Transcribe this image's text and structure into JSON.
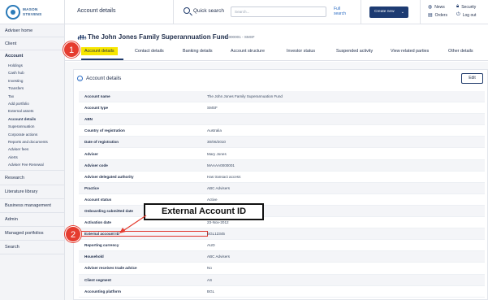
{
  "logo": {
    "line1": "MASON",
    "line2": "STEVENS"
  },
  "sidebar": {
    "items_top": [
      "Adviser home",
      "Client"
    ],
    "account_section": "Account",
    "account_sub": [
      "Holdings",
      "Cash hub",
      "Investing",
      "Transfers",
      "Tax",
      "Add portfolio",
      "External assets",
      "Account details",
      "Superannuation",
      "Corporate actions",
      "Reports and documents",
      "Adviser fees",
      "Alerts",
      "Adviser Fee Renewal"
    ],
    "active_sub": "Account details",
    "items_bottom": [
      "Research",
      "Literature library",
      "Business management",
      "Admin",
      "Managed portfolios",
      "Search"
    ]
  },
  "header": {
    "page_title": "Account details",
    "quick_search_label": "Quick search",
    "search_placeholder": "Search...",
    "full_search_line1": "Full",
    "full_search_line2": "search",
    "create_new_label": "Create new",
    "links": {
      "news": "News",
      "orders": "Orders",
      "security": "Security",
      "logout": "Log out"
    }
  },
  "fund": {
    "title": "The John Jones Family Superannuation Fund",
    "id": "MS1000001 - SMSF"
  },
  "tabs": [
    "Account details",
    "Contact details",
    "Banking details",
    "Account structure",
    "Investor status",
    "Suspended activity",
    "View related parties",
    "Other details"
  ],
  "panel": {
    "title": "Account details",
    "edit_label": "Edit",
    "fields": [
      {
        "key": "Account name",
        "value": "The John Jones Family Superannuation Fund"
      },
      {
        "key": "Account type",
        "value": "SMSF"
      },
      {
        "key": "ABN",
        "value": ""
      },
      {
        "key": "Country of registration",
        "value": "Australia"
      },
      {
        "key": "Date of registration",
        "value": "30/06/2010"
      },
      {
        "key": "Adviser",
        "value": "Mary Jones"
      },
      {
        "key": "Adviser code",
        "value": "MAAAA0000001"
      },
      {
        "key": "Adviser delegated authority",
        "value": "Has transact access"
      },
      {
        "key": "Practice",
        "value": "ABC Advisers"
      },
      {
        "key": "Account status",
        "value": "Active"
      },
      {
        "key": "Onboarding submitted date",
        "value": ""
      },
      {
        "key": "Activation date",
        "value": "23-Nov-2012"
      },
      {
        "key": "External account ID",
        "value": "BGL12345"
      },
      {
        "key": "Reporting currency",
        "value": "AUD"
      },
      {
        "key": "Household",
        "value": "ABC Advisers"
      },
      {
        "key": "Adviser receives trade advice",
        "value": "No"
      },
      {
        "key": "Client segment",
        "value": "AS"
      },
      {
        "key": "Accounting platform",
        "value": "BGL"
      }
    ]
  },
  "callouts": {
    "badge1": "1",
    "badge2": "2",
    "external_label": "External Account ID"
  },
  "colors": {
    "accent_yellow": "#f7e600",
    "navy": "#1d3b72",
    "callout_red": "#e53c2f"
  }
}
